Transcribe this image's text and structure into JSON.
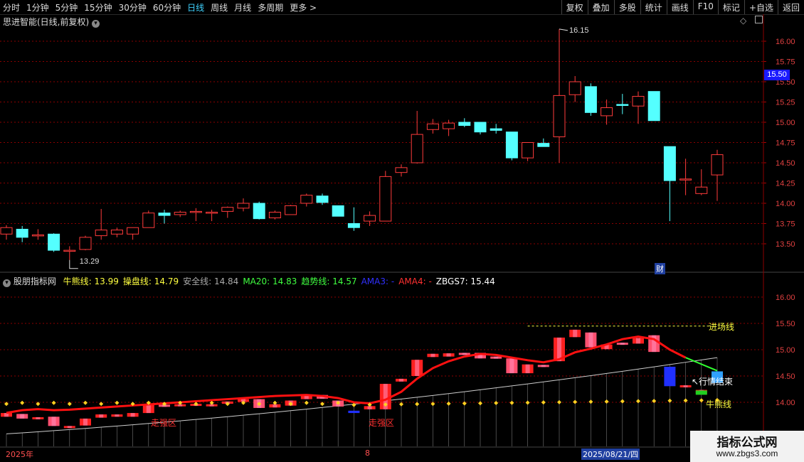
{
  "toolbar": {
    "periods": [
      "分时",
      "1分钟",
      "5分钟",
      "15分钟",
      "30分钟",
      "60分钟",
      "日线",
      "周线",
      "月线",
      "多周期",
      "更多 >"
    ],
    "active_period": "日线",
    "actions": [
      "复权",
      "叠加",
      "多股",
      "统计",
      "画线",
      "F10",
      "标记",
      "+自选",
      "返回"
    ]
  },
  "main": {
    "title": "思进智能(日线,前复权)",
    "high_label": "16.15",
    "low_label": "13.29",
    "current_price": "15.50",
    "fin_marker": "财"
  },
  "indicator": {
    "title": "股朋指标网",
    "fields": [
      {
        "label": "牛熊线:",
        "value": "13.99",
        "color": "#ffff40"
      },
      {
        "label": "操盘线:",
        "value": "14.79",
        "color": "#ffff40"
      },
      {
        "label": "安全线:",
        "value": "14.84",
        "color": "#aaaaaa"
      },
      {
        "label": "MA20:",
        "value": "14.83",
        "color": "#40ff40"
      },
      {
        "label": "趋势线:",
        "value": "14.57",
        "color": "#40ff40"
      },
      {
        "label": "AMA3:",
        "value": "-",
        "color": "#3030ff"
      },
      {
        "label": "AMA4:",
        "value": "-",
        "color": "#ff3030"
      },
      {
        "label": "ZBGS7:",
        "value": "15.44",
        "color": "#ffffff"
      }
    ],
    "entry_line_label": "进场线",
    "bull_bear_label": "牛熊线",
    "trend_end_label": "↖行情结束",
    "strong_zone_label": "走强区"
  },
  "axis": {
    "main_ticks": [
      "16.00",
      "15.75",
      "15.50",
      "15.25",
      "15.00",
      "14.75",
      "14.50",
      "14.25",
      "14.00",
      "13.75",
      "13.50"
    ],
    "ind_ticks": [
      "16.00",
      "15.50",
      "15.00",
      "14.50",
      "14.00"
    ]
  },
  "dates": {
    "year": "2025年",
    "month": "8",
    "cursor": "2025/08/21/四"
  },
  "watermark": {
    "line1": "指标公式网",
    "line2": "www.zbgs3.com"
  },
  "colors": {
    "up": "#ff3b3b",
    "down": "#54ffff",
    "bg": "#000000",
    "grid": "#8b0000"
  },
  "chart_data": {
    "type": "candlestick",
    "title": "思进智能(日线,前复权)",
    "ylim": [
      13.3,
      16.2
    ],
    "candles": [
      {
        "o": 13.62,
        "h": 13.73,
        "l": 13.55,
        "c": 13.7
      },
      {
        "o": 13.68,
        "h": 13.72,
        "l": 13.52,
        "c": 13.58
      },
      {
        "o": 13.61,
        "h": 13.68,
        "l": 13.55,
        "c": 13.61
      },
      {
        "o": 13.62,
        "h": 13.63,
        "l": 13.4,
        "c": 13.42
      },
      {
        "o": 13.42,
        "h": 13.47,
        "l": 13.3,
        "c": 13.42
      },
      {
        "o": 13.43,
        "h": 13.6,
        "l": 13.42,
        "c": 13.58
      },
      {
        "o": 13.6,
        "h": 13.93,
        "l": 13.55,
        "c": 13.67
      },
      {
        "o": 13.62,
        "h": 13.7,
        "l": 13.58,
        "c": 13.67
      },
      {
        "o": 13.62,
        "h": 13.7,
        "l": 13.55,
        "c": 13.7
      },
      {
        "o": 13.7,
        "h": 13.91,
        "l": 13.7,
        "c": 13.88
      },
      {
        "o": 13.88,
        "h": 13.92,
        "l": 13.75,
        "c": 13.85
      },
      {
        "o": 13.86,
        "h": 13.91,
        "l": 13.83,
        "c": 13.89
      },
      {
        "o": 13.9,
        "h": 13.94,
        "l": 13.78,
        "c": 13.9
      },
      {
        "o": 13.89,
        "h": 13.92,
        "l": 13.78,
        "c": 13.89
      },
      {
        "o": 13.9,
        "h": 13.96,
        "l": 13.82,
        "c": 13.95
      },
      {
        "o": 13.94,
        "h": 14.06,
        "l": 13.9,
        "c": 14.0
      },
      {
        "o": 14.0,
        "h": 14.02,
        "l": 13.8,
        "c": 13.81
      },
      {
        "o": 13.82,
        "h": 13.91,
        "l": 13.8,
        "c": 13.89
      },
      {
        "o": 13.86,
        "h": 13.98,
        "l": 13.86,
        "c": 13.97
      },
      {
        "o": 14.0,
        "h": 14.12,
        "l": 13.96,
        "c": 14.1
      },
      {
        "o": 14.09,
        "h": 14.12,
        "l": 13.98,
        "c": 14.01
      },
      {
        "o": 13.97,
        "h": 13.97,
        "l": 13.84,
        "c": 13.84
      },
      {
        "o": 13.75,
        "h": 13.95,
        "l": 13.66,
        "c": 13.7
      },
      {
        "o": 13.78,
        "h": 13.9,
        "l": 13.72,
        "c": 13.85
      },
      {
        "o": 13.78,
        "h": 14.4,
        "l": 13.78,
        "c": 14.33
      },
      {
        "o": 14.38,
        "h": 14.48,
        "l": 14.33,
        "c": 14.44
      },
      {
        "o": 14.5,
        "h": 15.14,
        "l": 14.49,
        "c": 14.85
      },
      {
        "o": 14.91,
        "h": 15.04,
        "l": 14.86,
        "c": 14.98
      },
      {
        "o": 14.92,
        "h": 15.03,
        "l": 14.83,
        "c": 14.99
      },
      {
        "o": 15.0,
        "h": 15.05,
        "l": 14.94,
        "c": 14.96
      },
      {
        "o": 15.0,
        "h": 15.0,
        "l": 14.85,
        "c": 14.88
      },
      {
        "o": 14.92,
        "h": 14.98,
        "l": 14.86,
        "c": 14.9
      },
      {
        "o": 14.88,
        "h": 14.88,
        "l": 14.53,
        "c": 14.56
      },
      {
        "o": 14.56,
        "h": 14.74,
        "l": 14.52,
        "c": 14.75
      },
      {
        "o": 14.74,
        "h": 14.8,
        "l": 14.72,
        "c": 14.7
      },
      {
        "o": 14.82,
        "h": 16.15,
        "l": 14.5,
        "c": 15.33
      },
      {
        "o": 15.34,
        "h": 15.57,
        "l": 15.25,
        "c": 15.5
      },
      {
        "o": 15.44,
        "h": 15.48,
        "l": 15.08,
        "c": 15.12
      },
      {
        "o": 15.08,
        "h": 15.28,
        "l": 14.97,
        "c": 15.18
      },
      {
        "o": 15.22,
        "h": 15.35,
        "l": 15.1,
        "c": 15.21
      },
      {
        "o": 15.2,
        "h": 15.38,
        "l": 14.98,
        "c": 15.32
      },
      {
        "o": 15.38,
        "h": 15.38,
        "l": 15.02,
        "c": 15.02
      },
      {
        "o": 14.7,
        "h": 14.7,
        "l": 13.78,
        "c": 14.28
      },
      {
        "o": 14.3,
        "h": 14.55,
        "l": 14.1,
        "c": 14.3
      },
      {
        "o": 14.12,
        "h": 14.42,
        "l": 14.1,
        "c": 14.2
      },
      {
        "o": 14.35,
        "h": 14.66,
        "l": 14.03,
        "c": 14.6
      }
    ]
  }
}
